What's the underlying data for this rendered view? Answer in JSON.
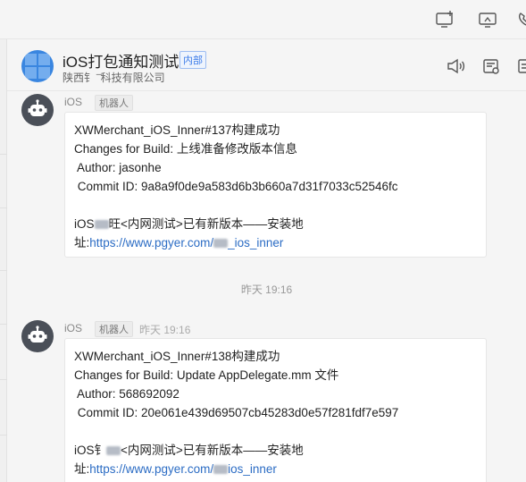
{
  "header": {
    "group_name": "iOS打包通知测试",
    "inner_tag": "内部",
    "company": "陕西钅 ̄ ̄科技有限公司"
  },
  "messages": [
    {
      "sender": "iOS",
      "bot_tag": "机器人",
      "time": "",
      "title": "XWMerchant_iOS_Inner#137构建成功",
      "changes": "Changes for Build: 上线准备修改版本信息",
      "author": " Author: jasonhe",
      "commit": " Commit ID: 9a8a9f0de9a583d6b3b660a7d31f7033c52546fc",
      "notice_prefix": "iOS",
      "notice_suffix": "旺<内网测试>已有新版本——安装地",
      "url_prefix": "址:",
      "url": "https://www.pgyer.com/",
      "url_suffix": "_ios_inner"
    },
    {
      "sender": "iOS",
      "bot_tag": "机器人",
      "time": "昨天 19:16",
      "title": "XWMerchant_iOS_Inner#138构建成功",
      "changes": "Changes for Build: Update AppDelegate.mm 文件",
      "author": " Author: 568692092",
      "commit": " Commit ID: 20e061e439d69507cb45283d0e57f281fdf7e597",
      "notice_prefix": "iOS钅",
      "notice_suffix": "<内网测试>已有新版本——安装地",
      "url_prefix": "址:",
      "url": "https://www.pgyer.com/",
      "url_suffix": "ios_inner"
    }
  ],
  "time_divider": "昨天 19:16",
  "icons": {
    "top": [
      "screen-add-icon",
      "screen-share-icon",
      "phone-icon"
    ],
    "header": [
      "announcement-icon",
      "notes-icon",
      "more-icon"
    ]
  },
  "colors": {
    "link": "#2b6cc4",
    "tag_blue": "#3b7be8",
    "group_avatar": "#3a86e0",
    "bot_avatar": "#4a4f58"
  }
}
